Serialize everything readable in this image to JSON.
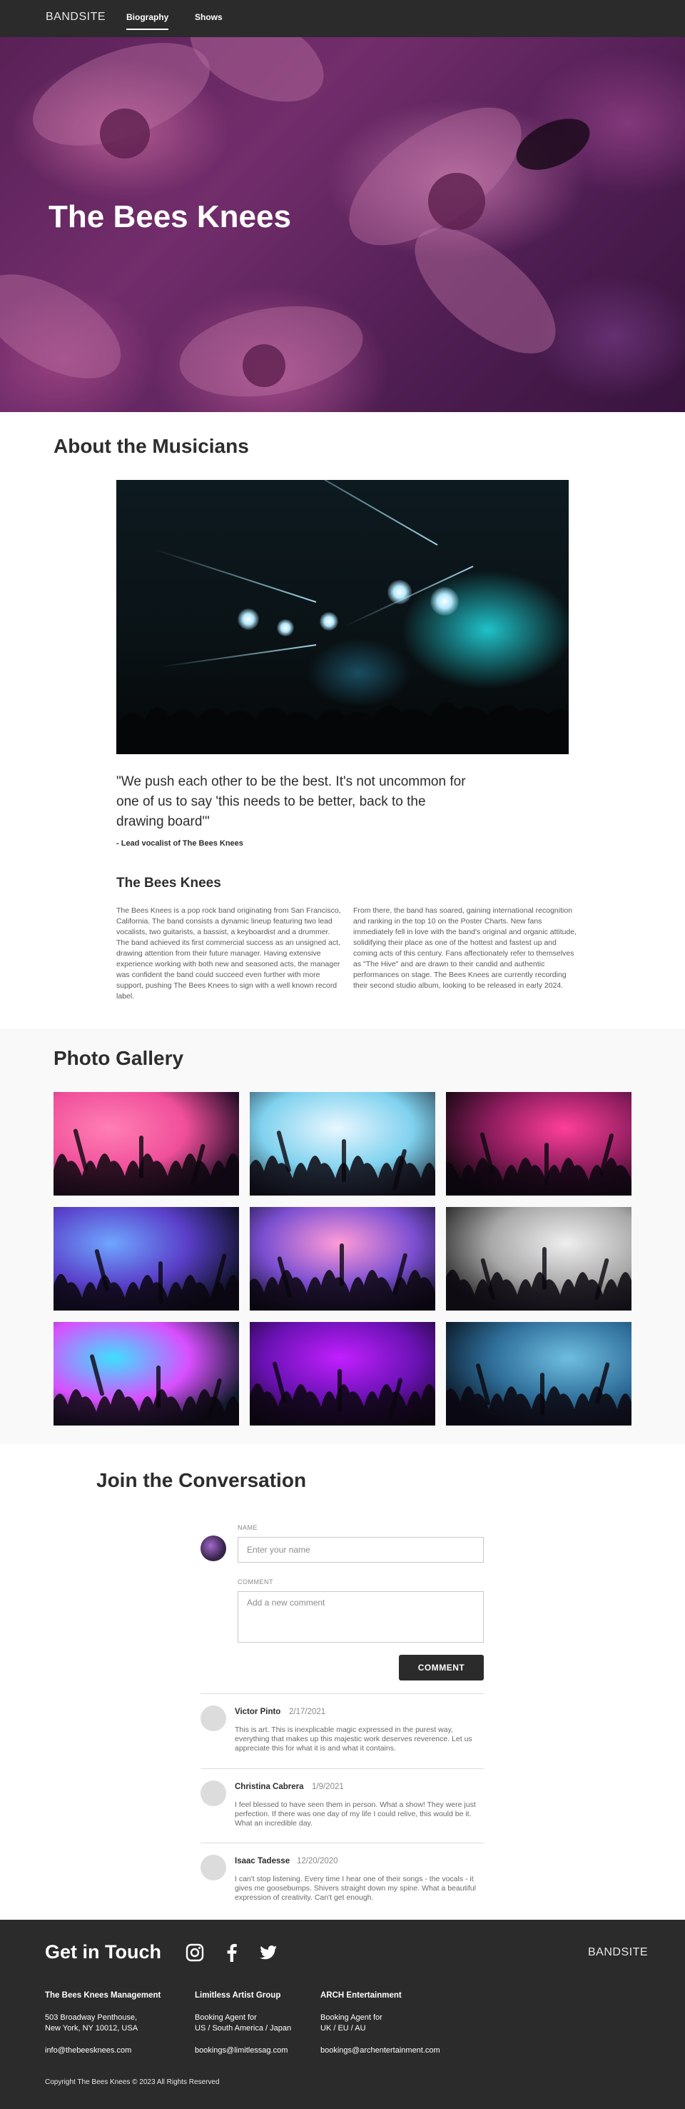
{
  "nav": {
    "brand": "BANDSITE",
    "links": [
      "Biography",
      "Shows"
    ],
    "active": "Biography"
  },
  "hero": {
    "title": "The Bees Knees"
  },
  "about": {
    "title": "About the Musicians",
    "quote": "\"We push each other to be the best. It's not uncommon for one of us to say 'this needs to be better, back to the drawing board'\"",
    "quote_by": "- Lead vocalist of The Bees Knees",
    "band_title": "The Bees Knees",
    "paragraph_1": "The Bees Knees is a pop rock band originating from San Francisco, California. The band consists a dynamic lineup featuring two lead vocalists, two guitarists, a bassist, a keyboardist and a drummer. The band achieved its first commercial success as an unsigned act, drawing attention from their future manager. Having extensive experience working with both new and seasoned acts, the manager was confident the band could succeed even further with more support, pushing The Bees Knees to sign with a well known record label.",
    "paragraph_2": "From there, the band has soared, gaining international recognition and ranking in the top 10 on the Poster Charts. New fans immediately fell in love with the band's original and organic attitude, solidifying their place as one of the hottest and fastest up and coming acts of this century. Fans affectionately refer to themselves as \"The Hive\" and are drawn to their candid and authentic performances on stage. The Bees Knees are currently recording their second studio album, looking to be released in early 2024."
  },
  "gallery": {
    "title": "Photo Gallery",
    "photos": [
      {
        "name": "crowd-hands-pink-smoke",
        "colors": [
          "#ff7fb3",
          "#f04f9a",
          "#2a0f2a"
        ]
      },
      {
        "name": "dancer-bright-light",
        "colors": [
          "#e8f7ff",
          "#7fd1ee",
          "#1d2c3a"
        ]
      },
      {
        "name": "hands-magenta-stage",
        "colors": [
          "#ff3f9a",
          "#8a1c5c",
          "#120810"
        ]
      },
      {
        "name": "woman-blue-lights",
        "colors": [
          "#6fa6ff",
          "#5a3fc9",
          "#10122a"
        ]
      },
      {
        "name": "fireworks-crowd",
        "colors": [
          "#ff9bd8",
          "#7b4fd1",
          "#0c0a20"
        ]
      },
      {
        "name": "smoke-woman-arms",
        "colors": [
          "#efefef",
          "#a8a8a8",
          "#2a2a2a"
        ]
      },
      {
        "name": "rainbow-lasers-crowd",
        "colors": [
          "#3fe0ff",
          "#d94fff",
          "#0f1a2a"
        ]
      },
      {
        "name": "dj-turntable-purple",
        "colors": [
          "#c21fff",
          "#6a12b4",
          "#12061e"
        ]
      },
      {
        "name": "confetti-crowd-blue",
        "colors": [
          "#6fbde0",
          "#2f6f9a",
          "#0c1a2a"
        ]
      }
    ]
  },
  "conversation": {
    "title": "Join the Conversation",
    "name_label": "NAME",
    "name_placeholder": "Enter your name",
    "comment_label": "COMMENT",
    "comment_placeholder": "Add a new comment",
    "button": "COMMENT",
    "comments": [
      {
        "name": "Victor Pinto",
        "date": "2/17/2021",
        "text": "This is art. This is inexplicable magic expressed in the purest way, everything that makes up this majestic work deserves reverence. Let us appreciate this for what it is and what it contains."
      },
      {
        "name": "Christina Cabrera",
        "date": "1/9/2021",
        "text": "I feel blessed to have seen them in person. What a show! They were just perfection. If there was one day of my life I could relive, this would be it. What an incredible day."
      },
      {
        "name": "Isaac Tadesse",
        "date": "12/20/2020",
        "text": "I can't stop listening. Every time I hear one of their songs - the vocals - it gives me goosebumps. Shivers straight down my spine. What a beautiful expression of creativity. Can't get enough."
      }
    ]
  },
  "footer": {
    "title": "Get in Touch",
    "brand": "BANDSITE",
    "social": [
      "instagram-icon",
      "facebook-icon",
      "twitter-icon"
    ],
    "columns": [
      {
        "heading": "The Bees Knees Management",
        "line1": "503 Broadway Penthouse,",
        "line2": "New York, NY 10012, USA",
        "email": "info@thebeesknees.com"
      },
      {
        "heading": "Limitless Artist Group",
        "line1": "Booking Agent for",
        "line2": "US / South America / Japan",
        "email": "bookings@limitlessag.com"
      },
      {
        "heading": "ARCH Entertainment",
        "line1": "Booking Agent for",
        "line2": "UK / EU / AU",
        "email": "bookings@archentertainment.com"
      }
    ],
    "copyright": "Copyright The Bees Knees © 2023 All Rights Reserved"
  }
}
